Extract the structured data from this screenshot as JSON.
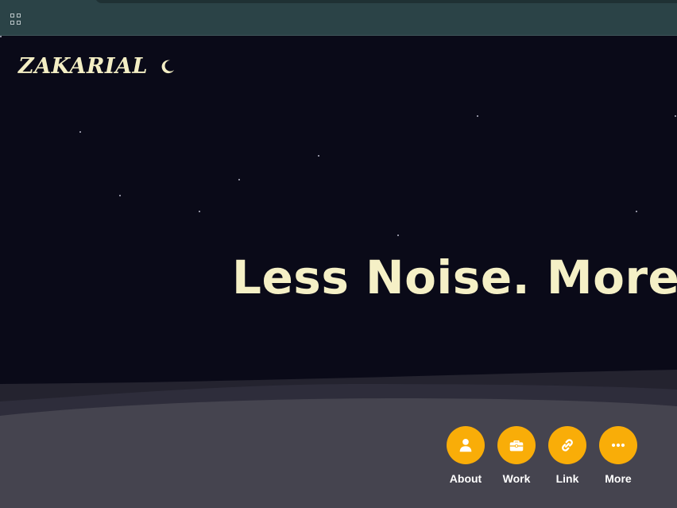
{
  "brand": {
    "name": "ZAKARIAL",
    "theme_icon": "moon-icon"
  },
  "hero": {
    "headline": "Less Noise. More Pu"
  },
  "nav": {
    "items": [
      {
        "label": "About",
        "icon": "user-icon"
      },
      {
        "label": "Work",
        "icon": "briefcase-icon"
      },
      {
        "label": "Link",
        "icon": "link-icon"
      },
      {
        "label": "More",
        "icon": "more-icon"
      }
    ]
  },
  "colors": {
    "background": "#0a0a18",
    "topbar": "#2b4347",
    "accent": "#f9ad08",
    "headline": "#f5f0c6"
  }
}
